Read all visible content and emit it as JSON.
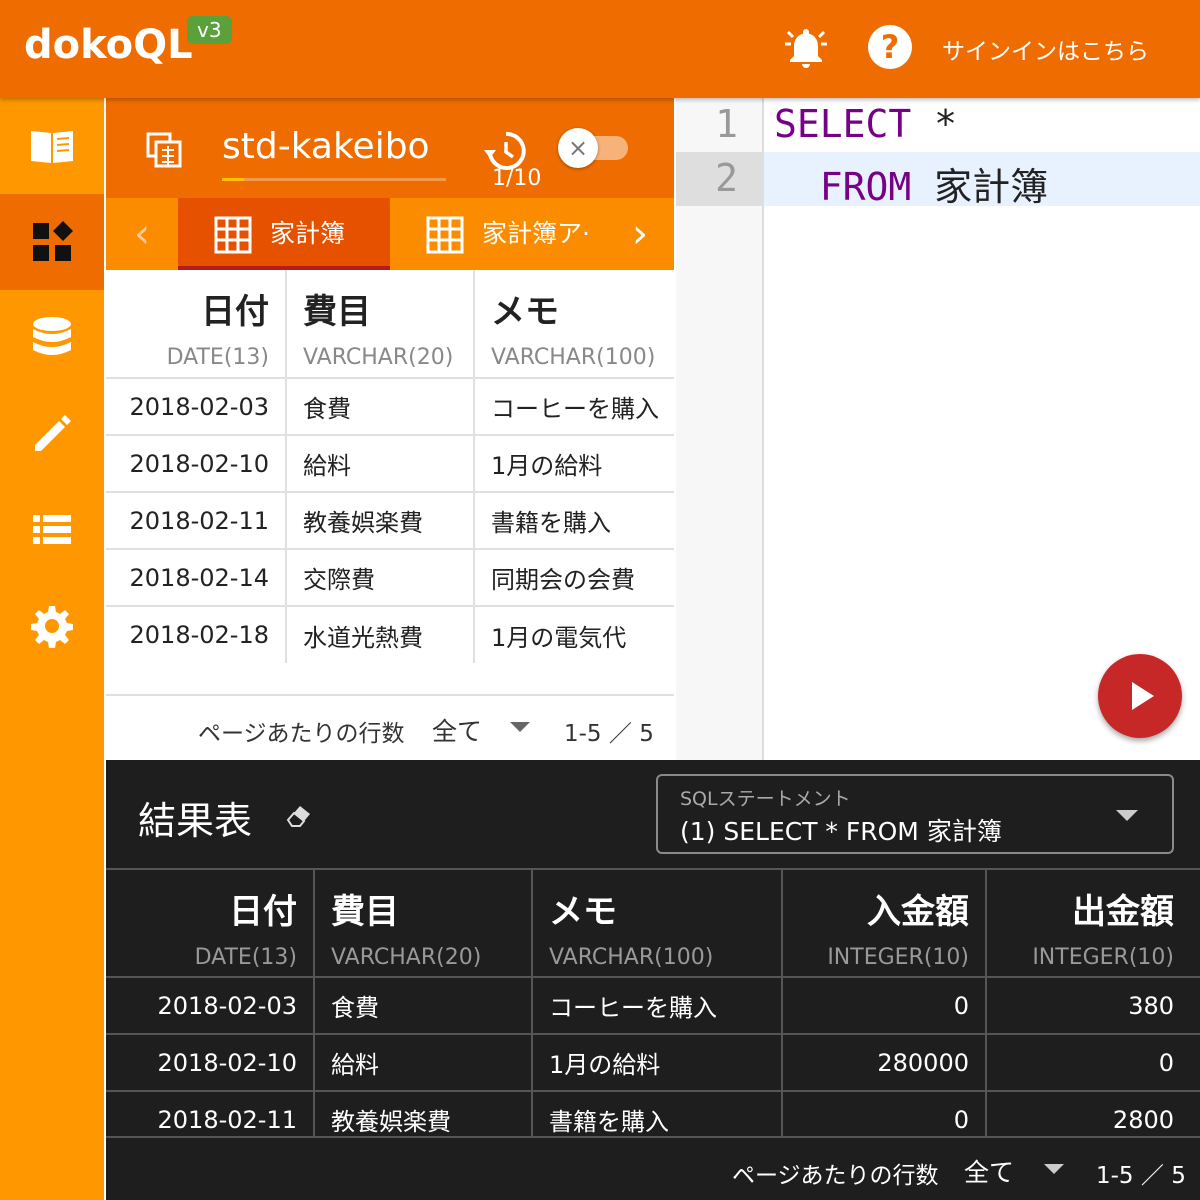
{
  "app": {
    "title": "dokoQL",
    "version_badge": "v3",
    "signin_label": "サインインはこちら",
    "help_glyph": "?",
    "icons": {
      "bell": "bell-icon",
      "help": "help-icon"
    },
    "colors": {
      "primary": "#ef6c00",
      "rail": "#ff9800",
      "run": "#c62828",
      "keyword": "#770088"
    }
  },
  "sidebar": {
    "items": [
      {
        "icon": "book-icon",
        "active": false
      },
      {
        "icon": "widgets-icon",
        "active": true
      },
      {
        "icon": "database-icon",
        "active": false
      },
      {
        "icon": "pencil-icon",
        "active": false
      },
      {
        "icon": "list-icon",
        "active": false
      },
      {
        "icon": "settings-icon",
        "active": false
      }
    ]
  },
  "db_panel": {
    "db_name": "std-kakeibo",
    "history_count": "1/10",
    "toggle_glyph": "×",
    "tabs": [
      {
        "label": "家計簿",
        "active": true
      },
      {
        "label": "家計簿ア·",
        "active": false
      }
    ],
    "table": {
      "columns": [
        {
          "name": "日付",
          "type": "DATE(13)"
        },
        {
          "name": "費目",
          "type": "VARCHAR(20)"
        },
        {
          "name": "メモ",
          "type": "VARCHAR(100)"
        }
      ],
      "rows": [
        [
          "2018-02-03",
          "食費",
          "コーヒーを購入"
        ],
        [
          "2018-02-10",
          "給料",
          "1月の給料"
        ],
        [
          "2018-02-11",
          "教養娯楽費",
          "書籍を購入"
        ],
        [
          "2018-02-14",
          "交際費",
          "同期会の会費"
        ],
        [
          "2018-02-18",
          "水道光熱費",
          "1月の電気代"
        ]
      ]
    },
    "pager": {
      "label": "ページあたりの行数",
      "value": "全て",
      "range": "1-5 ／ 5"
    }
  },
  "editor": {
    "lines": [
      {
        "number": "1",
        "keyword": "SELECT",
        "rest": " *"
      },
      {
        "number": "2",
        "keyword": "  FROM",
        "rest": " 家計簿"
      }
    ],
    "active_line": 2
  },
  "results": {
    "title": "結果表",
    "statement_label": "SQLステートメント",
    "statement_value": "(1) SELECT * FROM 家計簿",
    "columns": [
      {
        "name": "日付",
        "type": "DATE(13)"
      },
      {
        "name": "費目",
        "type": "VARCHAR(20)"
      },
      {
        "name": "メモ",
        "type": "VARCHAR(100)"
      },
      {
        "name": "入金額",
        "type": "INTEGER(10)"
      },
      {
        "name": "出金額",
        "type": "INTEGER(10)"
      }
    ],
    "rows": [
      [
        "2018-02-03",
        "食費",
        "コーヒーを購入",
        "0",
        "380"
      ],
      [
        "2018-02-10",
        "給料",
        "1月の給料",
        "280000",
        "0"
      ],
      [
        "2018-02-11",
        "教養娯楽費",
        "書籍を購入",
        "0",
        "2800"
      ]
    ],
    "pager": {
      "label": "ページあたりの行数",
      "value": "全て",
      "range": "1-5 ／ 5"
    }
  }
}
